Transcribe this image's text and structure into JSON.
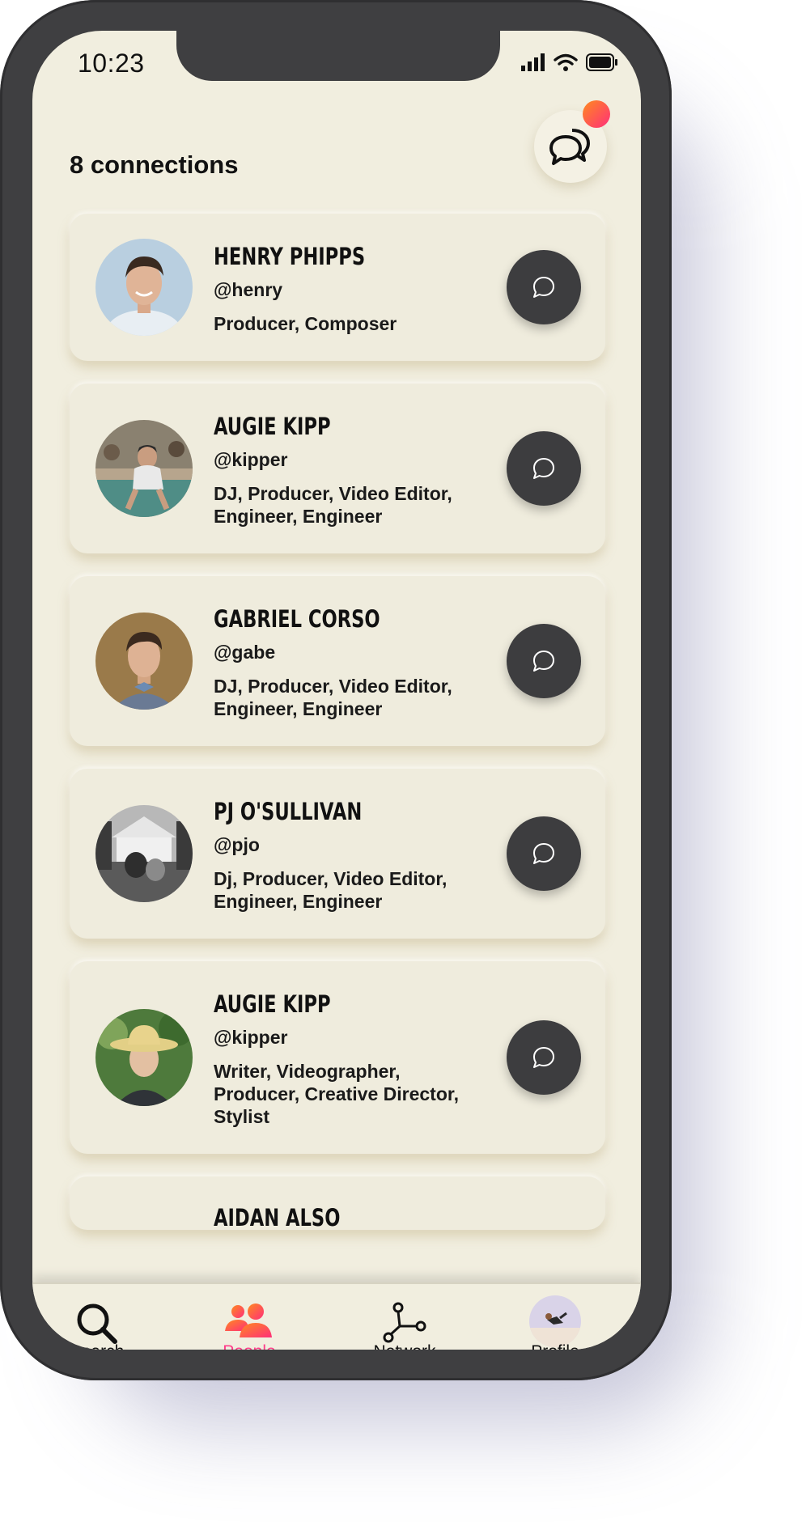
{
  "status": {
    "time": "10:23"
  },
  "header": {
    "connections_label": "8 connections"
  },
  "connections": [
    {
      "name": "HENRY PHIPPS",
      "handle": "@henry",
      "roles": "Producer, Composer"
    },
    {
      "name": "AUGIE KIPP",
      "handle": "@kipper",
      "roles": "DJ, Producer, Video Editor, Engineer, Engineer"
    },
    {
      "name": "GABRIEL CORSO",
      "handle": "@gabe",
      "roles": "DJ, Producer, Video Editor, Engineer, Engineer"
    },
    {
      "name": "PJ O'SULLIVAN",
      "handle": "@pjo",
      "roles": "Dj, Producer, Video Editor, Engineer, Engineer"
    },
    {
      "name": "AUGIE KIPP",
      "handle": "@kipper",
      "roles": "Writer, Videographer, Producer, Creative Director, Stylist"
    },
    {
      "name": "AIDAN ALSO"
    }
  ],
  "tabs": [
    {
      "label": "Search",
      "icon": "search-icon",
      "active": false
    },
    {
      "label": "People",
      "icon": "people-icon",
      "active": true
    },
    {
      "label": "Network",
      "icon": "network-icon",
      "active": false
    },
    {
      "label": "Profile",
      "icon": "profile-avatar",
      "active": false
    }
  ],
  "colors": {
    "background": "#f1eedf",
    "accent_gradient_start": "#ff8a1f",
    "accent_gradient_end": "#ff2f7a",
    "active_tab": "#ff3d8a",
    "dark_button": "#3d3d3f"
  }
}
